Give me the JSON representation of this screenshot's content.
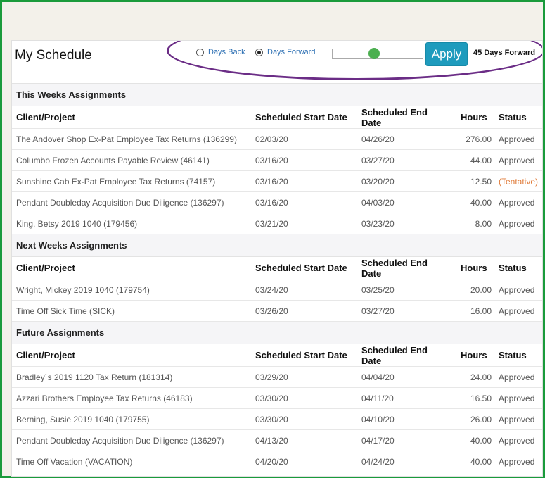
{
  "page_title": "My Schedule",
  "controls": {
    "days_back_label": "Days Back",
    "days_forward_label": "Days Forward",
    "selected": "Days Forward",
    "slider_fraction": 0.45,
    "apply_label": "Apply",
    "days_forward_text": "45 Days Forward",
    "slider_color": "#4caf50",
    "apply_color": "#1e9bbd"
  },
  "columns": {
    "client": "Client/Project",
    "start": "Scheduled  Start Date",
    "end": "Scheduled End Date",
    "hours": "Hours",
    "status": "Status"
  },
  "sections": [
    {
      "title": "This Weeks Assignments",
      "rows": [
        {
          "client": "The Andover Shop Ex-Pat Employee Tax Returns (136299)",
          "start": "02/03/20",
          "end": "04/26/20",
          "hours": "276.00",
          "status": "Approved"
        },
        {
          "client": "Columbo Frozen Accounts Payable Review (46141)",
          "start": "03/16/20",
          "end": "03/27/20",
          "hours": "44.00",
          "status": "Approved"
        },
        {
          "client": "Sunshine Cab Ex-Pat Employee Tax Returns (74157)",
          "start": "03/16/20",
          "end": "03/20/20",
          "hours": "12.50",
          "status": "(Tentative)"
        },
        {
          "client": "Pendant Doubleday Acquisition Due Diligence (136297)",
          "start": "03/16/20",
          "end": "04/03/20",
          "hours": "40.00",
          "status": "Approved"
        },
        {
          "client": "King, Betsy 2019 1040 (179456)",
          "start": "03/21/20",
          "end": "03/23/20",
          "hours": "8.00",
          "status": "Approved"
        }
      ]
    },
    {
      "title": "Next Weeks Assignments",
      "rows": [
        {
          "client": "Wright, Mickey 2019 1040 (179754)",
          "start": "03/24/20",
          "end": "03/25/20",
          "hours": "20.00",
          "status": "Approved"
        },
        {
          "client": "Time Off Sick Time (SICK)",
          "start": "03/26/20",
          "end": "03/27/20",
          "hours": "16.00",
          "status": "Approved"
        }
      ]
    },
    {
      "title": "Future Assignments",
      "rows": [
        {
          "client": "Bradley`s 2019 1120 Tax Return (181314)",
          "start": "03/29/20",
          "end": "04/04/20",
          "hours": "24.00",
          "status": "Approved"
        },
        {
          "client": "Azzari Brothers Employee Tax Returns (46183)",
          "start": "03/30/20",
          "end": "04/11/20",
          "hours": "16.50",
          "status": "Approved"
        },
        {
          "client": "Berning, Susie 2019 1040 (179755)",
          "start": "03/30/20",
          "end": "04/10/20",
          "hours": "26.00",
          "status": "Approved"
        },
        {
          "client": "Pendant Doubleday Acquisition Due Diligence (136297)",
          "start": "04/13/20",
          "end": "04/17/20",
          "hours": "40.00",
          "status": "Approved"
        },
        {
          "client": "Time Off Vacation (VACATION)",
          "start": "04/20/20",
          "end": "04/24/20",
          "hours": "40.00",
          "status": "Approved"
        }
      ]
    }
  ]
}
